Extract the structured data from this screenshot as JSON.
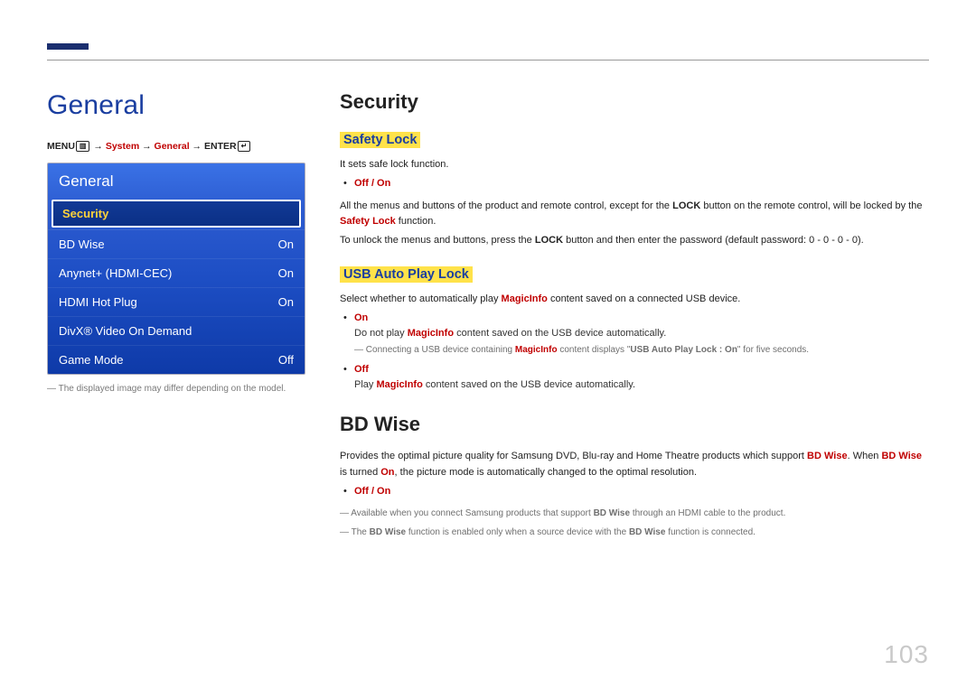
{
  "page_number": "103",
  "left": {
    "title": "General",
    "breadcrumb": {
      "menu": "MENU",
      "menu_icon": "▥",
      "sep": " → ",
      "system": "System",
      "general": "General",
      "enter": "ENTER",
      "enter_icon": "↵"
    },
    "osd": {
      "title": "General",
      "selected": "Security",
      "rows": [
        {
          "label": "BD Wise",
          "value": "On"
        },
        {
          "label": "Anynet+ (HDMI-CEC)",
          "value": "On"
        },
        {
          "label": "HDMI Hot Plug",
          "value": "On"
        },
        {
          "label": "DivX® Video On Demand",
          "value": ""
        },
        {
          "label": "Game Mode",
          "value": "Off"
        }
      ]
    },
    "footnote": "The displayed image may differ depending on the model."
  },
  "right": {
    "security": {
      "heading": "Security",
      "safety_lock": {
        "title": "Safety Lock",
        "desc1": "It sets safe lock function.",
        "options": "Off / On",
        "desc2_pre": "All the menus and buttons of the product and remote control, except for the ",
        "lock_word": "LOCK",
        "desc2_mid": " button on the remote control, will be locked by the ",
        "safety_lock_word": "Safety Lock",
        "desc2_post": " function.",
        "desc3_pre": "To unlock the menus and buttons, press the ",
        "desc3_mid": " button and then enter the password (default password: 0 - 0 - 0 - 0)."
      },
      "usb": {
        "title": "USB Auto Play Lock",
        "desc_pre": "Select whether to automatically play ",
        "magicinfo": "MagicInfo",
        "desc_post": " content saved on a connected USB device.",
        "opt_on": "On",
        "on_desc_pre": "Do not play ",
        "on_desc_post": " content saved on the USB device automatically.",
        "note_on_pre": "Connecting a USB device containing ",
        "note_on_mid": " content displays \"",
        "note_on_str": "USB Auto Play Lock : On",
        "note_on_post": "\" for five seconds.",
        "opt_off": "Off",
        "off_desc_pre": "Play ",
        "off_desc_post": " content saved on the USB device automatically."
      }
    },
    "bdwise": {
      "heading": "BD Wise",
      "desc_pre": "Provides the optimal picture quality for Samsung DVD, Blu-ray and Home Theatre products which support ",
      "bdwise_word": "BD Wise",
      "desc_mid1": ". When ",
      "desc_mid2": " is turned ",
      "on_word": "On",
      "desc_post": ", the picture mode is automatically changed to the optimal resolution.",
      "options": "Off / On",
      "note1_pre": "Available when you connect Samsung products that support ",
      "note1_post": " through an HDMI cable to the product.",
      "note2_pre": "The ",
      "note2_mid": " function is enabled only when a source device with the ",
      "note2_post": " function is connected."
    }
  }
}
